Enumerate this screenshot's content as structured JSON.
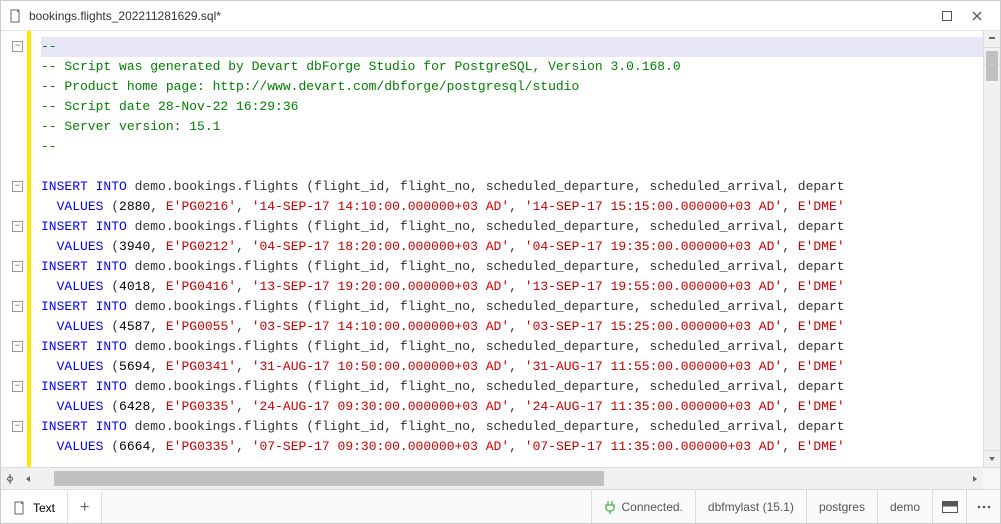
{
  "window": {
    "title": "bookings.flights_202211281629.sql*"
  },
  "comments": [
    "--",
    "-- Script was generated by Devart dbForge Studio for PostgreSQL, Version 3.0.168.0",
    "-- Product home page: http://www.devart.com/dbforge/postgresql/studio",
    "-- Script date 28-Nov-22 16:29:36",
    "-- Server version: 15.1",
    "--"
  ],
  "insert_prefix": "INSERT INTO",
  "values_prefix": "VALUES",
  "target_table": "demo.bookings.flights",
  "columns_list": "(flight_id, flight_no, scheduled_departure, scheduled_arrival, depart",
  "rows": [
    {
      "id": "2880",
      "no": "E'PG0216'",
      "dep": "'14-SEP-17 14:10:00.000000+03 AD'",
      "arr": "'14-SEP-17 15:15:00.000000+03 AD'",
      "tail": "E'DME'"
    },
    {
      "id": "3940",
      "no": "E'PG0212'",
      "dep": "'04-SEP-17 18:20:00.000000+03 AD'",
      "arr": "'04-SEP-17 19:35:00.000000+03 AD'",
      "tail": "E'DME'"
    },
    {
      "id": "4018",
      "no": "E'PG0416'",
      "dep": "'13-SEP-17 19:20:00.000000+03 AD'",
      "arr": "'13-SEP-17 19:55:00.000000+03 AD'",
      "tail": "E'DME'"
    },
    {
      "id": "4587",
      "no": "E'PG0055'",
      "dep": "'03-SEP-17 14:10:00.000000+03 AD'",
      "arr": "'03-SEP-17 15:25:00.000000+03 AD'",
      "tail": "E'DME'"
    },
    {
      "id": "5694",
      "no": "E'PG0341'",
      "dep": "'31-AUG-17 10:50:00.000000+03 AD'",
      "arr": "'31-AUG-17 11:55:00.000000+03 AD'",
      "tail": "E'DME'"
    },
    {
      "id": "6428",
      "no": "E'PG0335'",
      "dep": "'24-AUG-17 09:30:00.000000+03 AD'",
      "arr": "'24-AUG-17 11:35:00.000000+03 AD'",
      "tail": "E'DME'"
    },
    {
      "id": "6664",
      "no": "E'PG0335'",
      "dep": "'07-SEP-17 09:30:00.000000+03 AD'",
      "arr": "'07-SEP-17 11:35:00.000000+03 AD'",
      "tail": "E'DME'"
    }
  ],
  "tabs": {
    "text_label": "Text",
    "add_label": "+"
  },
  "status": {
    "connected_label": "Connected.",
    "server": "dbfmylast (15.1)",
    "user": "postgres",
    "database": "demo"
  }
}
